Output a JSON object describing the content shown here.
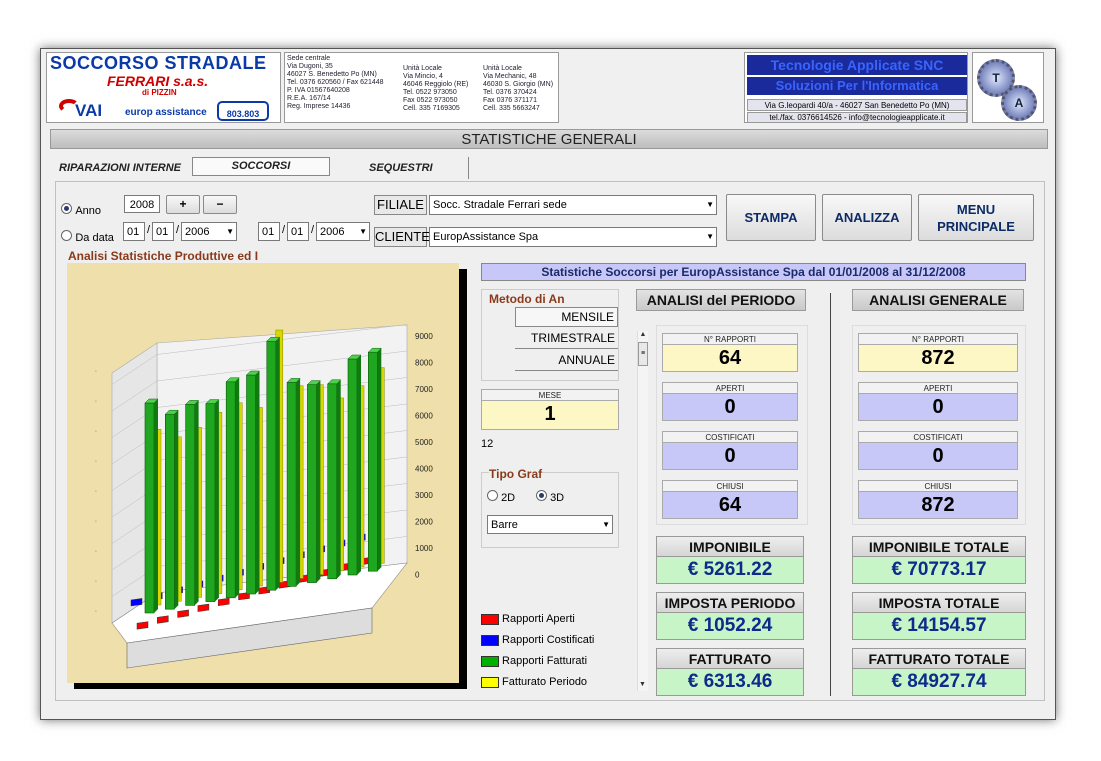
{
  "logo_left": {
    "title": "SOCCORSO STRADALE",
    "subtitle": "FERRARI s.a.s.",
    "di": "di PIZZIN",
    "vai": "VAI",
    "europ": "europ assistance",
    "phone": "803.803",
    "addr1": [
      "Sede centrale",
      "Via Dugoni, 35",
      "46027 S. Benedetto Po (MN)",
      "Tel. 0376 620560 / Fax 621448",
      "P. IVA 01567640208",
      "R.E.A. 167/14",
      "Reg. Imprese 14436"
    ],
    "addr2": [
      "Unità Locale",
      "Via Mincio, 4",
      "46046 Reggiolo (RE)",
      "Tel. 0522 973050",
      "Fax 0522 973050",
      "Cell. 335 7169305"
    ],
    "addr3": [
      "Unità Locale",
      "Via Mechanic, 48",
      "46030 S. Giorgio (MN)",
      "Tel. 0376 370424",
      "Fax 0376 371171",
      "Cell. 335 5663247"
    ]
  },
  "logo_right": {
    "line1": "Tecnologie Applicate SNC",
    "line2": "Soluzioni Per l'Informatica",
    "addr": "Via G.leopardi 40/a - 46027 San Benedetto Po (MN)",
    "contact": "tel./fax. 0376614526 - info@tecnologieapplicate.it",
    "seal1": "T",
    "seal2": "A"
  },
  "page_title": "STATISTICHE GENERALI",
  "tabs": [
    "RIPARAZIONI INTERNE",
    "SOCCORSI",
    "SEQUESTRI"
  ],
  "filters": {
    "anno_label": "Anno",
    "anno": "2008",
    "plus": "+",
    "minus": "−",
    "dadata_label": "Da data",
    "d1": [
      "01",
      "01",
      "2006"
    ],
    "d2": [
      "01",
      "01",
      "2006"
    ],
    "filiale_label": "FILIALE",
    "filiale": "Socc. Stradale Ferrari sede",
    "cliente_label": "CLIENTE",
    "cliente": "EuropAssistance Spa"
  },
  "buttons": {
    "stampa": "STAMPA",
    "analizza": "ANALIZZA",
    "menu1": "MENU",
    "menu2": "PRINCIPALE"
  },
  "chart_caption": "Analisi Statistiche Produttive ed I",
  "banner": "Statistiche Soccorsi per EuropAssistance Spa dal 01/01/2008 al 31/12/2008",
  "metodo": {
    "label": "Metodo di An",
    "options": [
      "MENSILE",
      "TRIMESTRALE",
      "ANNUALE"
    ]
  },
  "mese": {
    "label": "MESE",
    "value": "1",
    "extra": "12"
  },
  "tipo": {
    "label": "Tipo Graf",
    "opt2d": "2D",
    "opt3d": "3D",
    "select": "Barre"
  },
  "legend": [
    {
      "label": "Rapporti Aperti",
      "color": "#ff0000"
    },
    {
      "label": "Rapporti Costificati",
      "color": "#0000ff"
    },
    {
      "label": "Rapporti Fatturati",
      "color": "#00b000"
    },
    {
      "label": "Fatturato Periodo",
      "color": "#ffff00"
    }
  ],
  "periodo": {
    "title": "ANALISI del PERIODO",
    "rapporti_label": "N° RAPPORTI",
    "rapporti": "64",
    "aperti_label": "APERTI",
    "aperti": "0",
    "costificati_label": "COSTIFICATI",
    "costificati": "0",
    "chiusi_label": "CHIUSI",
    "chiusi": "64",
    "imponibile_label": "IMPONIBILE",
    "imponibile": "€ 5261.22",
    "imposta_label": "IMPOSTA PERIODO",
    "imposta": "€ 1052.24",
    "fatturato_label": "FATTURATO",
    "fatturato": "€ 6313.46"
  },
  "generale": {
    "title": "ANALISI GENERALE",
    "rapporti_label": "N° RAPPORTI",
    "rapporti": "872",
    "aperti_label": "APERTI",
    "aperti": "0",
    "costificati_label": "COSTIFICATI",
    "costificati": "0",
    "chiusi_label": "CHIUSI",
    "chiusi": "872",
    "imponibile_label": "IMPONIBILE TOTALE",
    "imponibile": "€ 70773.17",
    "imposta_label": "IMPOSTA TOTALE",
    "imposta": "€ 14154.57",
    "fatturato_label": "FATTURATO TOTALE",
    "fatturato": "€ 84927.74"
  },
  "chart_data": {
    "type": "bar",
    "series": [
      {
        "name": "Rapporti Fatturati",
        "values": [
          70,
          65,
          67,
          66,
          72,
          73,
          83,
          68,
          66,
          65,
          72,
          73
        ]
      },
      {
        "name": "Fatturato Periodo",
        "values": [
          6200,
          5800,
          6000,
          6400,
          6600,
          6300,
          8900,
          6800,
          6700,
          6100,
          6400,
          6900
        ]
      }
    ],
    "right_ticks": [
      "9000",
      "8000",
      "7000",
      "6000",
      "5000",
      "4000",
      "3000",
      "2000",
      "1000",
      "0"
    ]
  }
}
